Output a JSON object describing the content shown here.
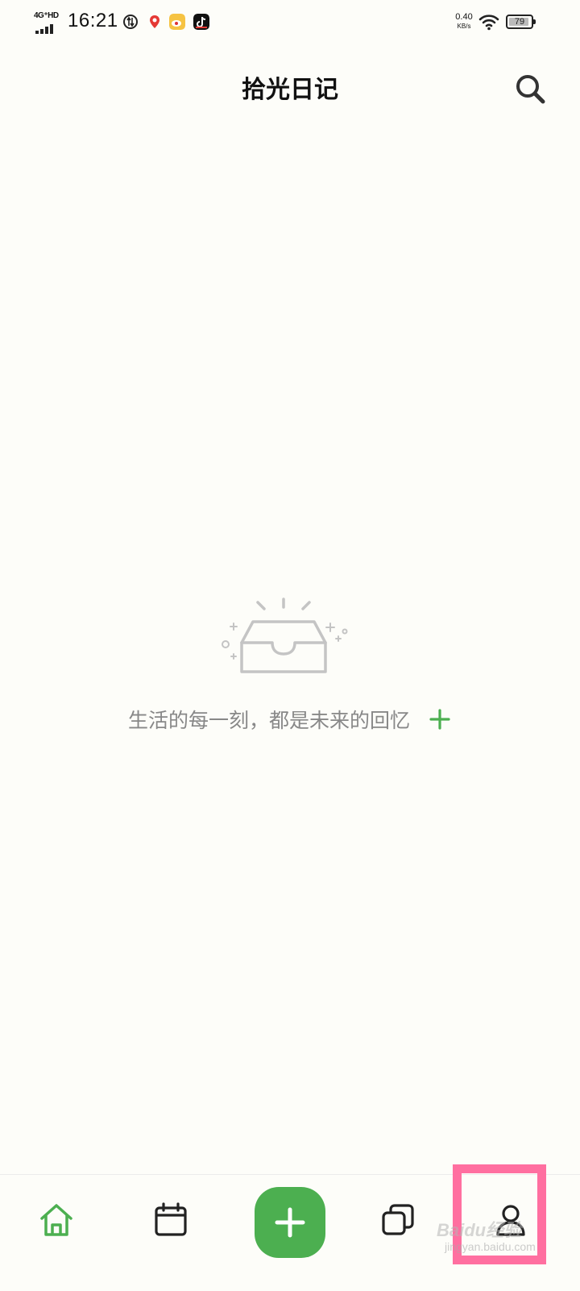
{
  "status_bar": {
    "network": "4G⁺HD",
    "time": "16:21",
    "net_speed_value": "0.40",
    "net_speed_unit": "KB/s",
    "battery_level": "79",
    "app_icons": [
      "data-saver-icon",
      "map-pin-app-icon",
      "weibo-app-icon",
      "tiktok-app-icon"
    ]
  },
  "header": {
    "title": "拾光日记",
    "search_icon": "search-icon"
  },
  "empty_state": {
    "illustration": "empty-inbox-icon",
    "message": "生活的每一刻，都是未来的回忆",
    "add_icon": "plus-icon"
  },
  "bottom_nav": {
    "items": [
      {
        "icon": "home-icon",
        "active": true
      },
      {
        "icon": "calendar-icon",
        "active": false
      },
      {
        "icon": "plus-icon",
        "active": false
      },
      {
        "icon": "layers-icon",
        "active": false
      },
      {
        "icon": "user-icon",
        "active": false
      }
    ]
  },
  "watermark": {
    "brand": "Baidu经验",
    "url": "jingyan.baidu.com"
  },
  "colors": {
    "accent": "#4caf50",
    "background": "#fdfdf9",
    "muted_text": "#888888",
    "highlight": "#ff6fa0"
  }
}
